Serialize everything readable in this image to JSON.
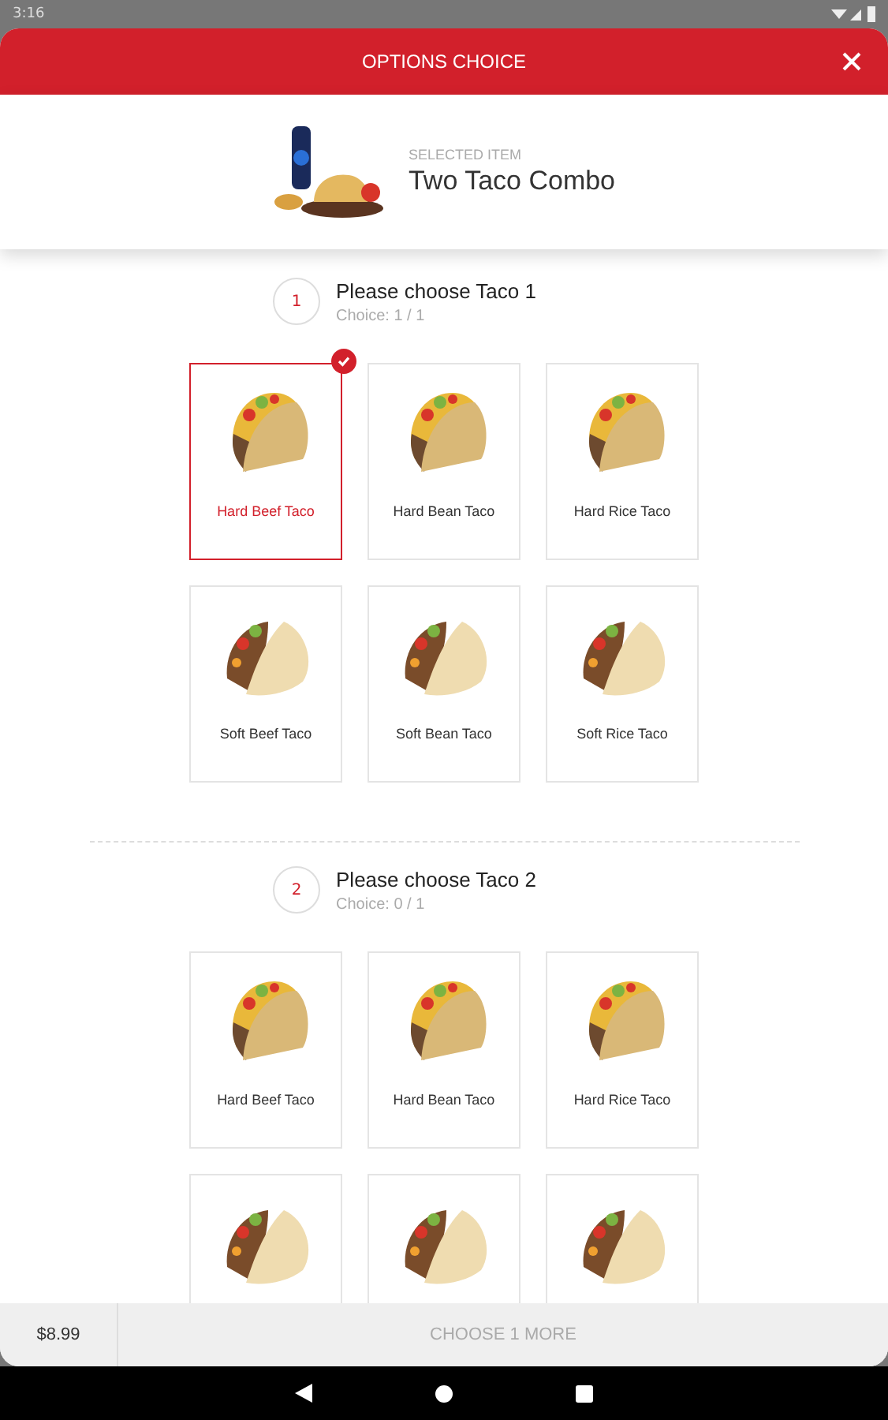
{
  "status_bar": {
    "time": "3:16"
  },
  "header": {
    "title": "OPTIONS CHOICE"
  },
  "selected_item": {
    "caption": "SELECTED ITEM",
    "name": "Two Taco Combo"
  },
  "groups": [
    {
      "number": "1",
      "title": "Please choose Taco 1",
      "choice": "Choice: 1 / 1",
      "items": [
        {
          "kind": "hard",
          "label": "Hard Beef Taco",
          "selected": true
        },
        {
          "kind": "hard",
          "label": "Hard Bean Taco",
          "selected": false
        },
        {
          "kind": "hard",
          "label": "Hard Rice Taco",
          "selected": false
        },
        {
          "kind": "soft",
          "label": "Soft Beef Taco",
          "selected": false
        },
        {
          "kind": "soft",
          "label": "Soft Bean Taco",
          "selected": false
        },
        {
          "kind": "soft",
          "label": "Soft Rice Taco",
          "selected": false
        }
      ]
    },
    {
      "number": "2",
      "title": "Please choose Taco 2",
      "choice": "Choice: 0 / 1",
      "items": [
        {
          "kind": "hard",
          "label": "Hard Beef Taco",
          "selected": false
        },
        {
          "kind": "hard",
          "label": "Hard Bean Taco",
          "selected": false
        },
        {
          "kind": "hard",
          "label": "Hard Rice Taco",
          "selected": false
        },
        {
          "kind": "soft"
        },
        {
          "kind": "soft"
        },
        {
          "kind": "soft"
        }
      ]
    }
  ],
  "footer": {
    "price": "$8.99",
    "action": "CHOOSE 1 MORE"
  }
}
